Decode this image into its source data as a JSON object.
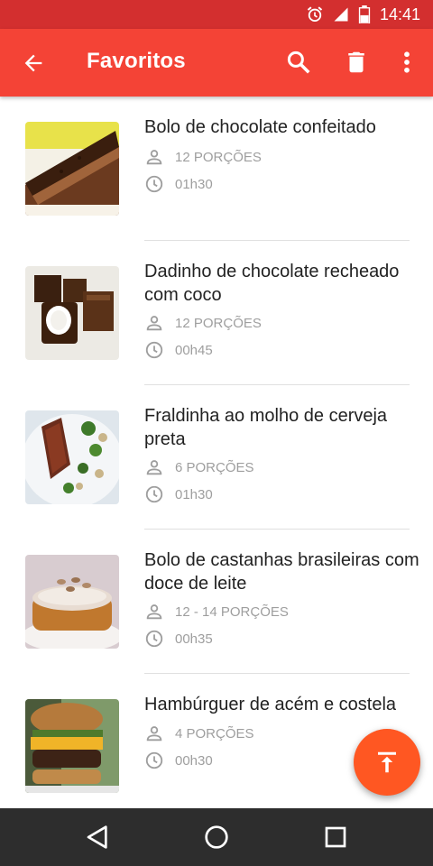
{
  "status_bar": {
    "time": "14:41",
    "icons": [
      "alarm-icon",
      "signal-icon",
      "battery-icon"
    ],
    "color": "#d32f2f"
  },
  "app_bar": {
    "title": "Favoritos",
    "color": "#f44336",
    "actions": [
      "back-arrow-icon",
      "search-icon",
      "trash-icon",
      "more-vert-icon"
    ]
  },
  "recipes": [
    {
      "title": "Bolo de chocolate confeitado",
      "servings": "12 PORÇÕES",
      "time": "01h30",
      "image": "chocolate-cake"
    },
    {
      "title": "Dadinho de chocolate recheado com coco",
      "servings": "12 PORÇÕES",
      "time": "00h45",
      "image": "chocolate-cubes"
    },
    {
      "title": "Fraldinha ao molho de cerveja preta",
      "servings": "6 PORÇÕES",
      "time": "01h30",
      "image": "steak-plate"
    },
    {
      "title": "Bolo de castanhas brasileiras com doce de leite",
      "servings": "12 - 14 PORÇÕES",
      "time": "00h35",
      "image": "nut-cake"
    },
    {
      "title": "Hambúrguer de acém e costela",
      "servings": "4 PORÇÕES",
      "time": "00h30",
      "image": "burger"
    }
  ],
  "fab": {
    "icon": "scroll-to-top-icon",
    "color": "#ff5722"
  },
  "nav_bar": {
    "icons": [
      "back-triangle-icon",
      "home-circle-icon",
      "recents-square-icon"
    ]
  }
}
